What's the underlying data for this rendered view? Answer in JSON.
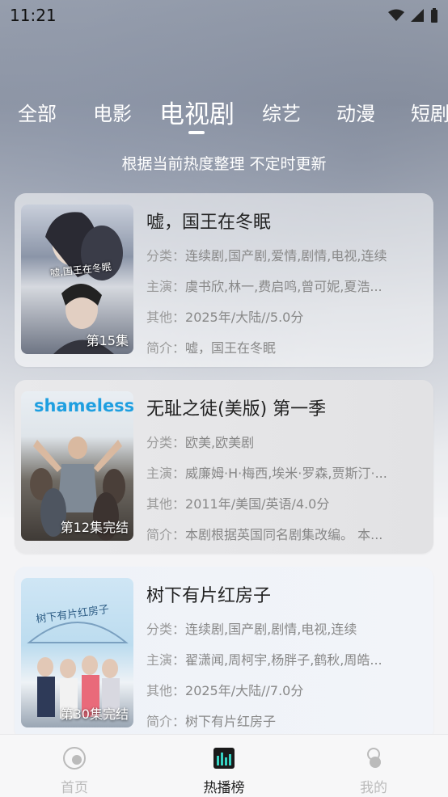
{
  "status": {
    "time": "11:21"
  },
  "tabs": [
    "全部",
    "电影",
    "电视剧",
    "综艺",
    "动漫",
    "短剧"
  ],
  "subtitle": "根据当前热度整理 不定时更新",
  "labels": {
    "category": "分类：",
    "cast": "主演：",
    "other": "其他：",
    "intro": "简介："
  },
  "items": [
    {
      "title": "嘘，国王在冬眠",
      "category": "连续剧,国产剧,爱情,剧情,电视,连续",
      "cast": "虞书欣,林一,费启鸣,曾可妮,夏浩...",
      "other": "2025年/大陆//5.0分",
      "intro": "嘘，国王在冬眠",
      "episode": "第15集",
      "poster_title": "嘘,国王在冬眠"
    },
    {
      "title": "无耻之徒(美版) 第一季",
      "category": "欧美,欧美剧",
      "cast": "威廉姆·H·梅西,埃米·罗森,贾斯汀·...",
      "other": "2011年/美国/英语/4.0分",
      "intro": "本剧根据英国同名剧集改编。 本...",
      "episode": "第12集完结",
      "poster_title": "shameless"
    },
    {
      "title": "树下有片红房子",
      "category": "连续剧,国产剧,剧情,电视,连续",
      "cast": "翟潇闻,周柯宇,杨胖子,鹤秋,周皓...",
      "other": "2025年/大陆//7.0分",
      "intro": "树下有片红房子",
      "episode": "第30集完结",
      "poster_title": "树下有片红房子"
    }
  ],
  "nav": {
    "home": "首页",
    "hot": "热播榜",
    "mine": "我的"
  }
}
